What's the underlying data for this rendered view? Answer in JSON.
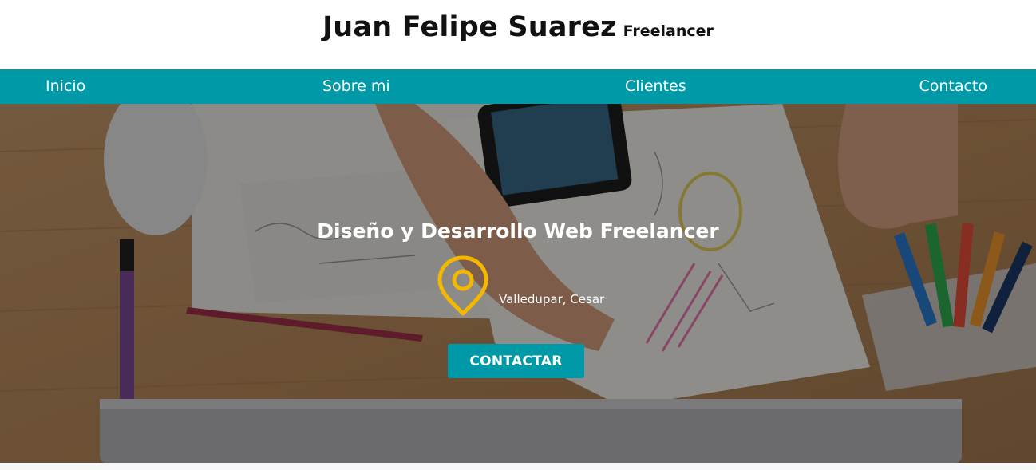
{
  "header": {
    "name": "Juan Felipe Suarez",
    "role": "Freelancer"
  },
  "nav": {
    "items": [
      "Inicio",
      "Sobre mi",
      "Clientes",
      "Contacto"
    ]
  },
  "hero": {
    "title": "Diseño y Desarrollo Web Freelancer",
    "location": "Valledupar, Cesar",
    "cta_label": "CONTACTAR",
    "background_description_icon": "desk-photo"
  },
  "colors": {
    "accent": "#0099a8",
    "pin": "#f5b800",
    "text_dark": "#111111",
    "text_light": "#ffffff"
  }
}
